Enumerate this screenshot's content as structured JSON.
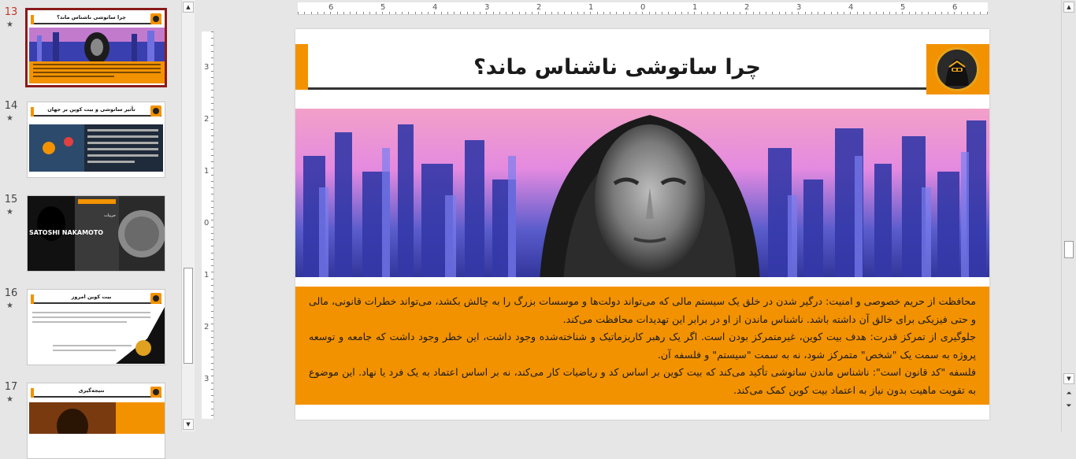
{
  "thumbnails": [
    {
      "number": "13",
      "star": "★",
      "title": "چرا ساتوشی ناشناس ماند؟",
      "active": true
    },
    {
      "number": "14",
      "star": "★",
      "title": "تأثیر ساتوشی و بیت کوین بر جهان",
      "active": false
    },
    {
      "number": "15",
      "star": "★",
      "title": "",
      "image_caption": "SATOSHI NAKAMOTO",
      "side_title": "جزییات",
      "active": false
    },
    {
      "number": "16",
      "star": "★",
      "title": "بیت کوین امروز",
      "active": false
    },
    {
      "number": "17",
      "star": "★",
      "title": "نتیجه‌گیری",
      "active": false
    }
  ],
  "ruler": {
    "horizontal_labels": [
      "6",
      "5",
      "4",
      "3",
      "2",
      "1",
      "0",
      "1",
      "2",
      "3",
      "4",
      "5",
      "6"
    ],
    "vertical_labels": [
      "3",
      "2",
      "1",
      "0",
      "1",
      "2",
      "3"
    ]
  },
  "slide": {
    "title": "چرا ساتوشی ناشناس ماند؟",
    "paragraphs": [
      "محافظت از حریم خصوصی و امنیت: درگیر شدن در خلق یک سیستم مالی که می‌تواند دولت‌ها و موسسات بزرگ را به چالش بکشد، می‌تواند خطرات قانونی، مالی و حتی فیزیکی برای خالق آن داشته باشد. ناشناس ماندن از او در برابر این تهدیدات محافظت می‌کند.",
      "جلوگیری از تمرکز قدرت: هدف بیت کوین، غیرمتمرکز بودن است. اگر یک رهبر کاریزماتیک و شناخته‌شده وجود داشت، این خطر وجود داشت که جامعه و توسعه پروژه به سمت یک \"شخص\" متمرکز شود، نه به سمت \"سیستم\" و فلسفه آن.",
      "فلسفه \"کد قانون است\": ناشناس ماندن ساتوشی تأکید می‌کند که بیت کوین بر اساس کد و ریاضیات کار می‌کند، نه بر اساس اعتماد به یک فرد یا نهاد. این موضوع به تقویت ماهیت بدون نیاز به اعتماد بیت کوین کمک می‌کند."
    ]
  },
  "colors": {
    "accent_orange": "#f39200",
    "active_thumb_border": "#8b1a1a",
    "hero_blue": "#3a3fb0",
    "hero_pink": "#f08cd8"
  },
  "icons": [
    "scroll-up-icon",
    "scroll-down-icon",
    "prev-slide-icon",
    "next-slide-icon",
    "hooded-figure-logo"
  ]
}
